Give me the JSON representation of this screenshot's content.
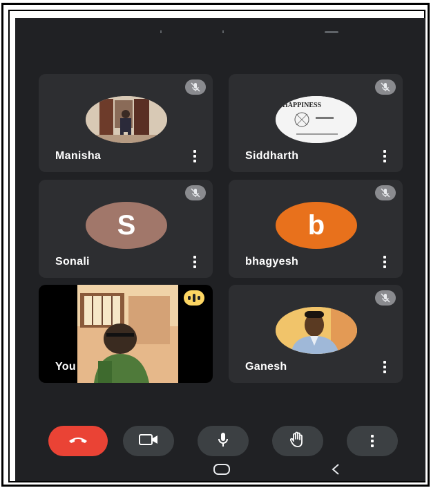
{
  "participants": [
    {
      "name": "Manisha",
      "muted": true,
      "avatar_type": "photo",
      "menu_icon": "more-vert-icon"
    },
    {
      "name": "Siddharth",
      "muted": true,
      "avatar_type": "photo",
      "avatar_text_line": "HAPPINESS",
      "menu_icon": "more-vert-icon"
    },
    {
      "name": "Sonali",
      "muted": true,
      "avatar_type": "letter",
      "avatar_letter": "S",
      "avatar_color": "#a1776a",
      "menu_icon": "more-vert-icon"
    },
    {
      "name": "bhagyesh",
      "muted": true,
      "avatar_type": "letter",
      "avatar_letter": "b",
      "avatar_color": "#e8711c",
      "menu_icon": "more-vert-icon"
    },
    {
      "name": "You",
      "muted": false,
      "speaking": true,
      "avatar_type": "video"
    },
    {
      "name": "Ganesh",
      "muted": true,
      "avatar_type": "photo",
      "menu_icon": "more-vert-icon"
    }
  ],
  "controls": {
    "end_call_icon": "phone-hangup-icon",
    "camera_icon": "videocam-icon",
    "mic_icon": "mic-icon",
    "raise_hand_icon": "hand-icon",
    "more_icon": "more-vert-icon"
  },
  "colors": {
    "background": "#202124",
    "tile": "#2d2e31",
    "end_call": "#ea4335",
    "control": "#3c4043",
    "speaking": "#fdd663",
    "mute_badge": "#8a8b8f"
  },
  "nav": {
    "home_icon": "home-pill-icon",
    "back_icon": "back-chevron-icon"
  }
}
